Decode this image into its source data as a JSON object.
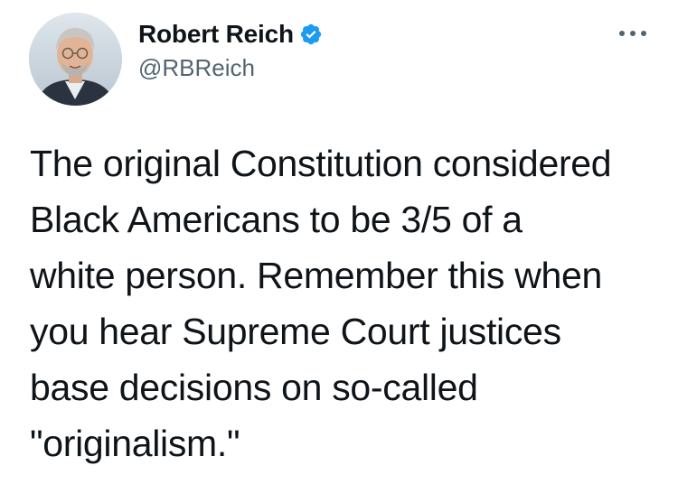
{
  "author": {
    "display_name": "Robert Reich",
    "handle": "@RBReich",
    "verified": true,
    "avatar_icon": "profile-photo",
    "verified_icon": "verified-badge-icon"
  },
  "actions": {
    "more_icon": "more-options-icon"
  },
  "tweet": {
    "text": "The original Constitution considered\nBlack Americans to be 3/5 of a\nwhite person. Remember this when\nyou hear Supreme Court justices\nbase decisions on so-called\n\"originalism.\""
  },
  "colors": {
    "text_primary": "#0f1419",
    "text_secondary": "#536471",
    "verified_blue": "#1d9bf0",
    "background": "#ffffff"
  }
}
